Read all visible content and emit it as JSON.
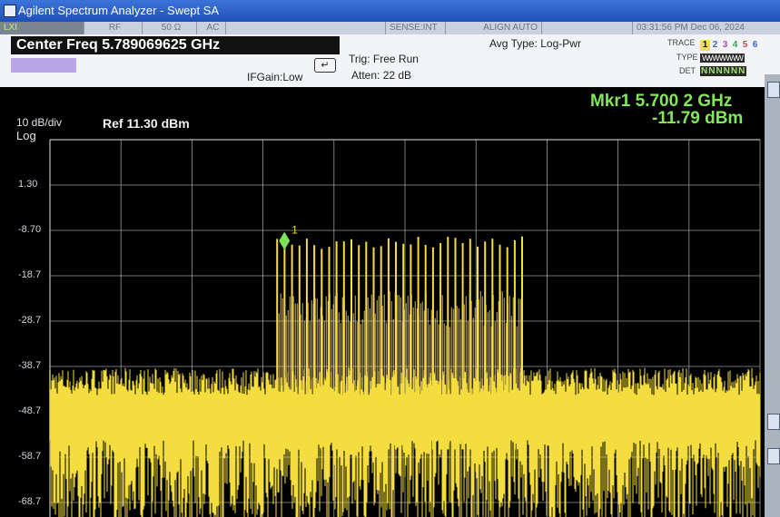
{
  "window": {
    "title": "Agilent Spectrum Analyzer - Swept SA"
  },
  "status": {
    "icon_label": "LXI",
    "rf": "RF",
    "impedance": "50 Ω",
    "coupling": "AC",
    "sense": "SENSE:INT",
    "align": "ALIGN AUTO",
    "datetime": "03:31:56 PM Dec 06, 2024"
  },
  "settings": {
    "center_freq": "Center Freq 5.789069625 GHz",
    "ifgain": "IFGain:Low",
    "trig": "Trig: Free Run",
    "atten": "Atten: 22 dB",
    "avg_type": "Avg Type: Log-Pwr",
    "trace_label": "TRACE",
    "trace_numbers": [
      "1",
      "2",
      "3",
      "4",
      "5",
      "6"
    ],
    "type_label": "TYPE",
    "type_value": "WWWWWW",
    "det_label": "DET",
    "det_value": "NNNNNN"
  },
  "display": {
    "scale_per_div": "10 dB/div",
    "scale_type": "Log",
    "ref_level": "Ref 11.30 dBm",
    "marker_freq": "Mkr1 5.700 2 GHz",
    "marker_amp": "-11.79 dBm",
    "marker_label": "1",
    "y_tick_labels": [
      "1.30",
      "-8.70",
      "-18.7",
      "-28.7",
      "-38.7",
      "-48.7",
      "-58.7",
      "-68.7"
    ]
  },
  "colors": {
    "trace": "#f4dd3e",
    "marker": "#7fe05a",
    "grid": "#c8ccd2"
  },
  "chart_data": {
    "type": "line",
    "title": "",
    "ylabel": "",
    "xlabel": "",
    "ylim": [
      -88.7,
      11.3
    ],
    "grid": true,
    "series": [
      {
        "name": "",
        "description_values": "noise floor approx -47 dBm across full span with peaks to about -40 dBm; comb of ~34 tones raised to approx -11 dBm between 32% and 66% of span",
        "noise_floor_dbm": -47,
        "noise_peak_dbm": -40,
        "comb_level_dbm": -12
      }
    ],
    "marker": {
      "label": "1",
      "freq": "5.700 2 GHz",
      "amplitude_dbm": -11.79
    }
  }
}
